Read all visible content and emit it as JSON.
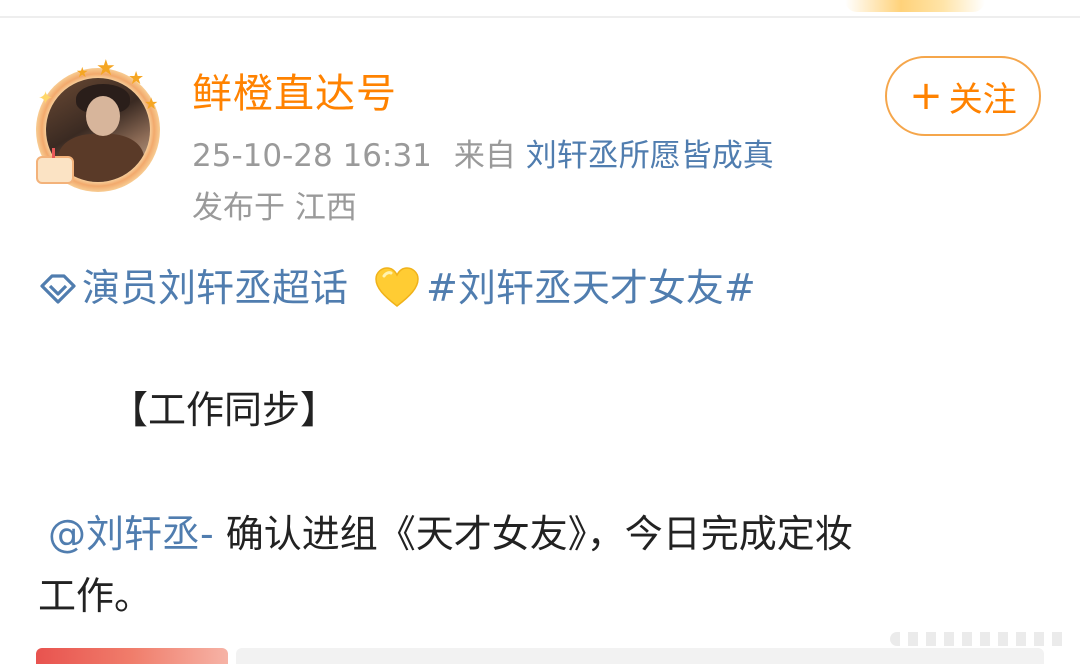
{
  "post": {
    "username": "鲜橙直达号",
    "follow_button": {
      "icon": "plus-icon",
      "label": "关注"
    },
    "timestamp": "25-10-28 16:31",
    "source_prefix": "来自",
    "source_name": "刘轩丞所愿皆成真",
    "location": "发布于 江西",
    "topic_icon": "diamond-icon",
    "topic": "演员刘轩丞超话",
    "emoji_icon": "yellow-heart-icon",
    "hashtag": "#刘轩丞天才女友#",
    "section_title": "【工作同步】",
    "mention": "@刘轩丞-",
    "body_line1": " 确认进组《天才女友》，今日完成定妆",
    "body_line2": "工作。"
  },
  "colors": {
    "username": "#ff8200",
    "link": "#507daf",
    "meta": "#9a9a9a",
    "text": "#222222",
    "follow_border": "#f5a64b"
  }
}
